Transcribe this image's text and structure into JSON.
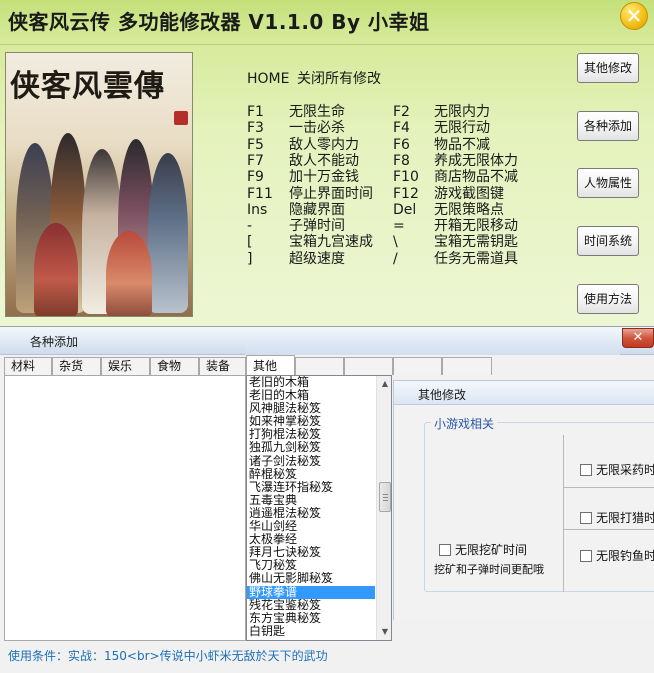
{
  "trainer": {
    "title": "侠客风云传 多功能修改器 V1.1.0 By 小幸姐",
    "close_glyph": "✕",
    "cover_title": "侠客风雲傳",
    "home_key": "HOME",
    "home_action": "关闭所有修改",
    "hotkeys": [
      {
        "k1": "F1",
        "a1": "无限生命",
        "k2": "F2",
        "a2": "无限内力"
      },
      {
        "k1": "F3",
        "a1": "一击必杀",
        "k2": "F4",
        "a2": "无限行动"
      },
      {
        "k1": "F5",
        "a1": "敌人零内力",
        "k2": "F6",
        "a2": "物品不减"
      },
      {
        "k1": "F7",
        "a1": "敌人不能动",
        "k2": "F8",
        "a2": "养成无限体力"
      },
      {
        "k1": "F9",
        "a1": "加十万金钱",
        "k2": "F10",
        "a2": "商店物品不减"
      },
      {
        "k1": "F11",
        "a1": "停止界面时间",
        "k2": "F12",
        "a2": "游戏截图键"
      },
      {
        "k1": "Ins",
        "a1": "隐藏界面",
        "k2": "Del",
        "a2": "无限策略点"
      },
      {
        "k1": "-",
        "a1": "子弹时间",
        "k2": "=",
        "a2": "开箱无限移动"
      },
      {
        "k1": "[",
        "a1": "宝箱九宫速成",
        "k2": "\\",
        "a2": "宝箱无需钥匙"
      },
      {
        "k1": "]",
        "a1": "超级速度",
        "k2": "/",
        "a2": "任务无需道具"
      }
    ],
    "buttons": [
      "其他修改",
      "各种添加",
      "人物属性",
      "时间系统",
      "使用方法"
    ]
  },
  "add_window": {
    "title": "各种添加",
    "close_glyph": "✕",
    "tabs": [
      "材料",
      "杂货",
      "娱乐",
      "食物",
      "装备",
      "其他"
    ],
    "active_tab": 5,
    "list_items": [
      "老旧的木箱",
      "老旧的木箱",
      "风神腿法秘笈",
      "如来神掌秘笈",
      "打狗棍法秘笈",
      "独孤九剑秘笈",
      "诸子剑法秘笈",
      "醉棍秘笈",
      "飞瀑连环指秘笈",
      "五毒宝典",
      "逍遥棍法秘笈",
      "华山剑经",
      "太极拳经",
      "拜月七诀秘笈",
      "飞刀秘笈",
      "佛山无影脚秘笈",
      "野球拳谱",
      "残花宝鉴秘笈",
      "东方宝典秘笈",
      "白钥匙"
    ],
    "selected_index": 16,
    "scroll_up": "▲",
    "scroll_down": "▼",
    "usage": "使用条件：实战：150<br>传说中小虾米无敌於天下的武功"
  },
  "other_panel": {
    "title": "其他修改",
    "group_label": "小游戏相关",
    "checkboxes": [
      "无限采药时",
      "无限打猎时",
      "无限钓鱼时",
      "无限挖矿时间"
    ],
    "dig_note": "挖矿和子弹时间更配哦"
  },
  "colors": {
    "trainer_bg": "#d6ea9a",
    "usage_text": "#1c6fb8",
    "selection": "#3399ff",
    "group_label": "#2a56a8",
    "close_button": "#f2c21a"
  }
}
